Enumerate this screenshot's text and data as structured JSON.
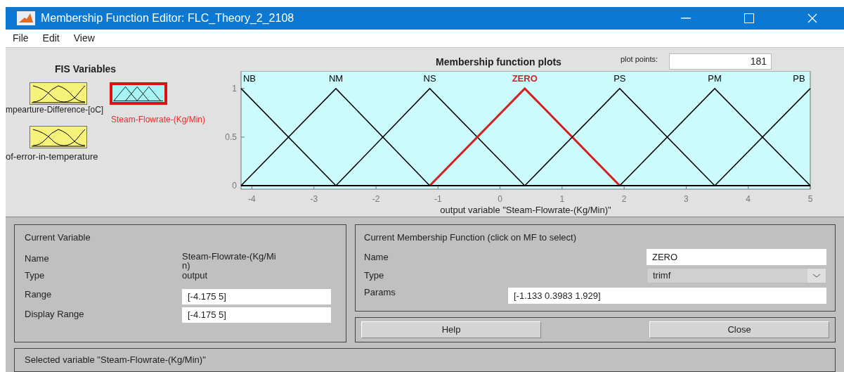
{
  "window": {
    "title": "Membership Function Editor: FLC_Theory_2_2108"
  },
  "menu": [
    "File",
    "Edit",
    "View"
  ],
  "fis_variables": {
    "title": "FIS Variables",
    "items": [
      {
        "label": "mpearture-Difference-[oC]",
        "kind": "input",
        "selected": false
      },
      {
        "label": "Steam-Flowrate-(Kg/Min)",
        "kind": "output",
        "selected": true
      },
      {
        "label": "of-error-in-temperature",
        "kind": "input",
        "selected": false
      }
    ]
  },
  "plot": {
    "title": "Membership function plots",
    "plot_points_label": "plot points:",
    "plot_points": "181",
    "chart_data": {
      "type": "line",
      "xlabel": "output variable \"Steam-Flowrate-(Kg/Min)\"",
      "x": [
        -4.175,
        -2.646,
        -1.133,
        0.3983,
        1.929,
        3.46,
        5
      ],
      "xlim": [
        -4.175,
        5
      ],
      "ylim": [
        -0.036,
        1.18
      ],
      "xticks": [
        -4,
        -3,
        -2,
        -1,
        0,
        1,
        2,
        3,
        4,
        5
      ],
      "yticks": [
        0,
        0.5,
        1
      ],
      "series": [
        {
          "name": "NB",
          "color": "#000000",
          "values": [
            1,
            0,
            null,
            null,
            null,
            null,
            null
          ]
        },
        {
          "name": "NM",
          "color": "#000000",
          "values": [
            0,
            1,
            0,
            null,
            null,
            null,
            null
          ]
        },
        {
          "name": "NS",
          "color": "#000000",
          "values": [
            null,
            0,
            1,
            0,
            null,
            null,
            null
          ]
        },
        {
          "name": "ZERO",
          "color": "#d42020",
          "values": [
            null,
            null,
            0,
            1,
            0,
            null,
            null
          ]
        },
        {
          "name": "PS",
          "color": "#000000",
          "values": [
            null,
            null,
            null,
            0,
            1,
            0,
            null
          ]
        },
        {
          "name": "PM",
          "color": "#000000",
          "values": [
            null,
            null,
            null,
            null,
            0,
            1,
            0
          ]
        },
        {
          "name": "PB",
          "color": "#000000",
          "values": [
            null,
            null,
            null,
            null,
            null,
            0,
            1
          ]
        }
      ]
    }
  },
  "current_variable": {
    "title": "Current Variable",
    "name_label": "Name",
    "name": "Steam-Flowrate-(Kg/Mi",
    "name_cont": "n)",
    "type_label": "Type",
    "type": "output",
    "range_label": "Range",
    "range": "[-4.175 5]",
    "display_range_label": "Display Range",
    "display_range": "[-4.175 5]"
  },
  "current_mf": {
    "title": "Current Membership Function (click on MF to select)",
    "name_label": "Name",
    "name": "ZERO",
    "type_label": "Type",
    "type": "trimf",
    "params_label": "Params",
    "params": "[-1.133 0.3983 1.929]"
  },
  "buttons": [
    "Help",
    "Close"
  ],
  "status": "Selected variable \"Steam-Flowrate-(Kg/Min)\""
}
